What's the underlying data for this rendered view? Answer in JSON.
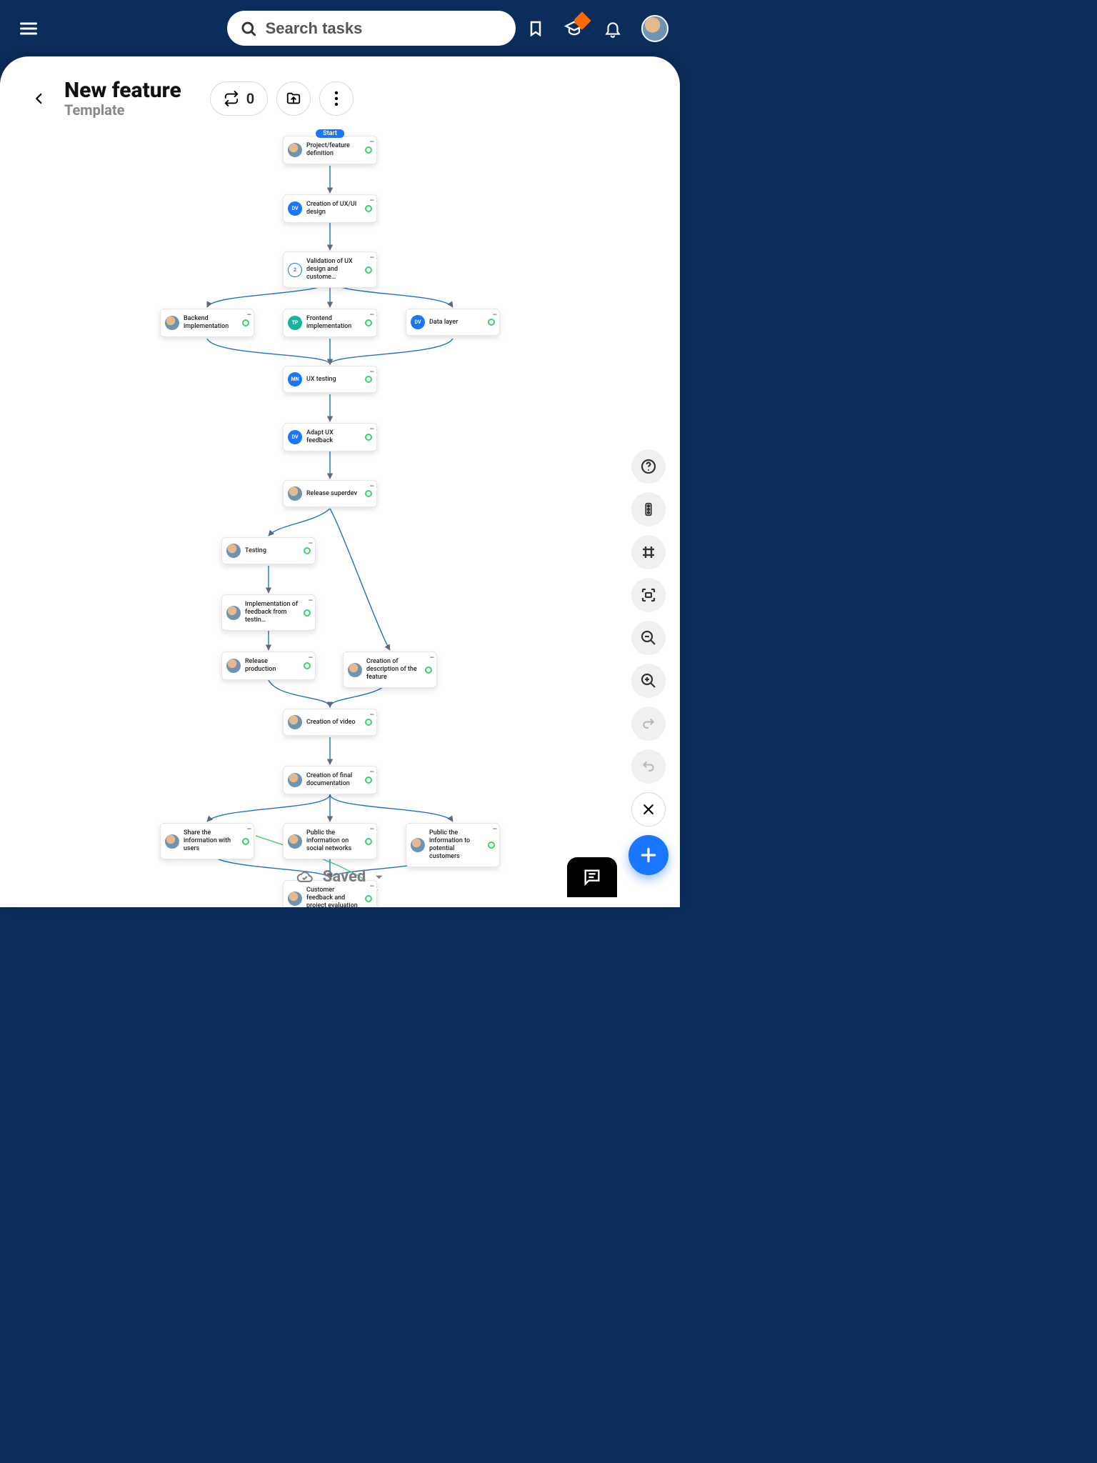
{
  "search": {
    "placeholder": "Search tasks"
  },
  "page": {
    "title": "New feature",
    "subtitle": "Template",
    "repeat_count": "0",
    "start_label": "Start"
  },
  "saved_label": "Saved",
  "nodes": {
    "n1": {
      "label": "Project/feature definition",
      "avatar": "photo"
    },
    "n2": {
      "label": "Creation of UX/UI design",
      "avatar": "DV",
      "avatarClass": "solid"
    },
    "n3": {
      "label": "Validation of UX design and custome…",
      "avatar": "2",
      "avatarClass": "count"
    },
    "n4": {
      "label": "Backend implementation",
      "avatar": "photo"
    },
    "n5": {
      "label": "Frontend implementation",
      "avatar": "TP",
      "avatarClass": "teal"
    },
    "n6": {
      "label": "Data layer",
      "avatar": "DV",
      "avatarClass": "solid"
    },
    "n7": {
      "label": "UX testing",
      "avatar": "MN",
      "avatarClass": "solid"
    },
    "n8": {
      "label": "Adapt UX feedback",
      "avatar": "DV",
      "avatarClass": "solid"
    },
    "n9": {
      "label": "Release superdev",
      "avatar": "photo"
    },
    "n10": {
      "label": "Testing",
      "avatar": "photo"
    },
    "n11": {
      "label": "Implementation of feedback from testin…",
      "avatar": "photo"
    },
    "n12": {
      "label": "Release production",
      "avatar": "photo"
    },
    "n13": {
      "label": "Creation of description of the feature",
      "avatar": "photo"
    },
    "n14": {
      "label": "Creation of video",
      "avatar": "photo"
    },
    "n15": {
      "label": "Creation of final documentation",
      "avatar": "photo"
    },
    "n16": {
      "label": "Share the information with users",
      "avatar": "photo"
    },
    "n17": {
      "label": "Public the information on social networks",
      "avatar": "photo"
    },
    "n18": {
      "label": "Public the information to potential customers",
      "avatar": "photo"
    },
    "n19": {
      "label": "Customer feedback and project evaluation",
      "avatar": "photo"
    }
  }
}
